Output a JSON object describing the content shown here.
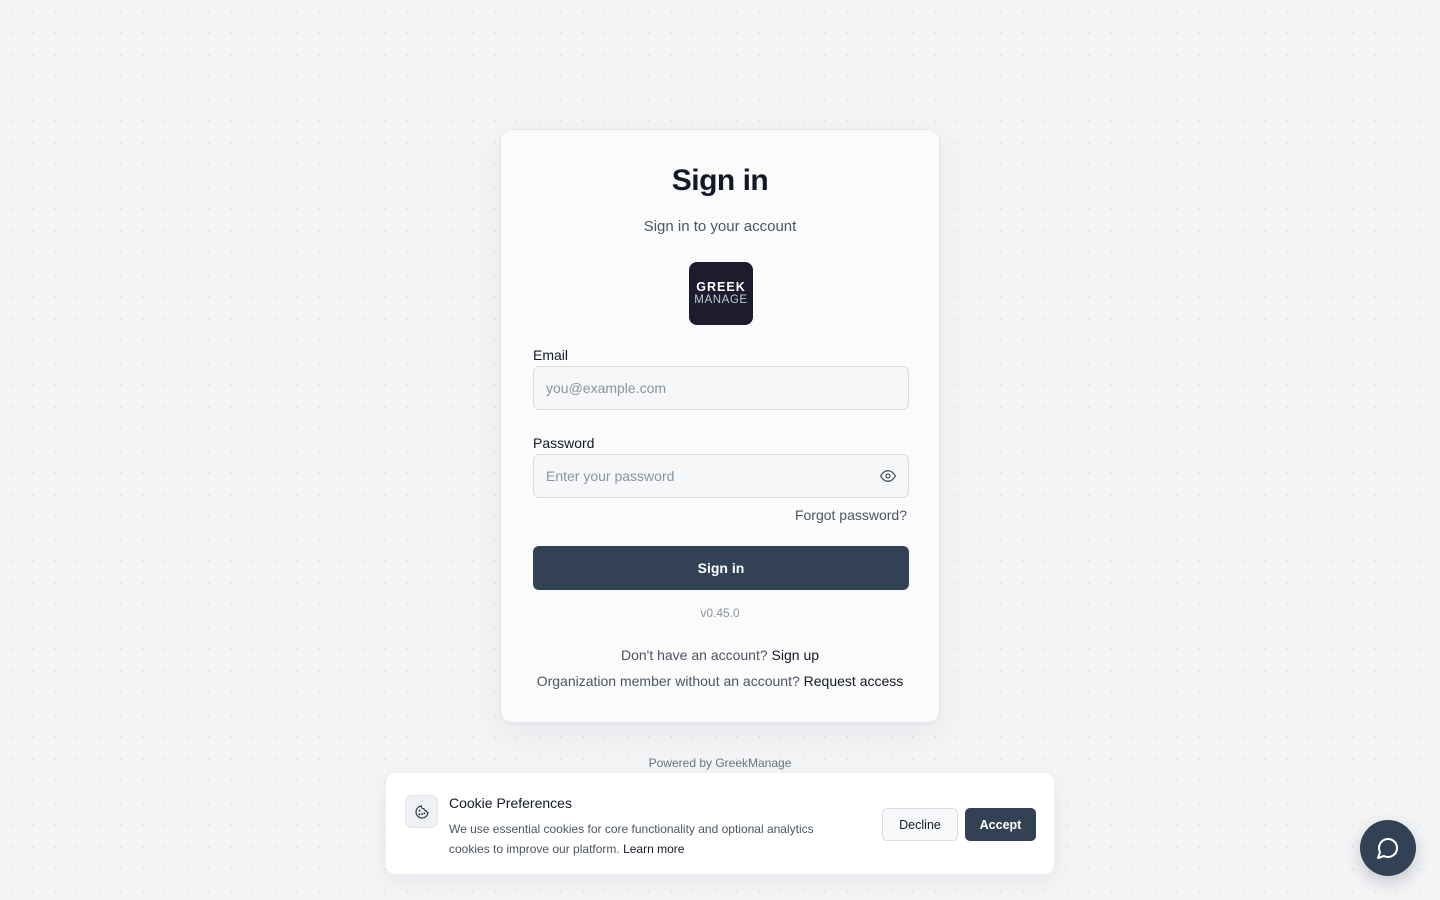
{
  "signin": {
    "title": "Sign in",
    "subtitle": "Sign in to your account",
    "logo": {
      "line1": "GREEK",
      "line2": "MANAGE"
    },
    "email": {
      "label": "Email",
      "placeholder": "you@example.com",
      "value": ""
    },
    "password": {
      "label": "Password",
      "placeholder": "Enter your password",
      "value": "",
      "toggle_icon": "eye-icon"
    },
    "forgot_label": "Forgot password?",
    "submit_label": "Sign in",
    "version": "v0.45.0",
    "signup": {
      "prompt": "Don't have an account? ",
      "link": "Sign up"
    },
    "request": {
      "prompt": "Organization member without an account? ",
      "link": "Request access"
    }
  },
  "footer": {
    "powered_by": "Powered by GreekManage"
  },
  "cookie_banner": {
    "icon": "cookie-icon",
    "title": "Cookie Preferences",
    "text": "We use essential cookies for core functionality and optional analytics cookies to improve our platform. ",
    "learn_more": "Learn more",
    "decline_label": "Decline",
    "accept_label": "Accept"
  },
  "chat": {
    "icon": "chat-bubble-icon"
  },
  "colors": {
    "primary": "#334155",
    "logo_bg": "#1c1c2e",
    "background": "#f3f4f6",
    "card": "#fbfbfc"
  }
}
